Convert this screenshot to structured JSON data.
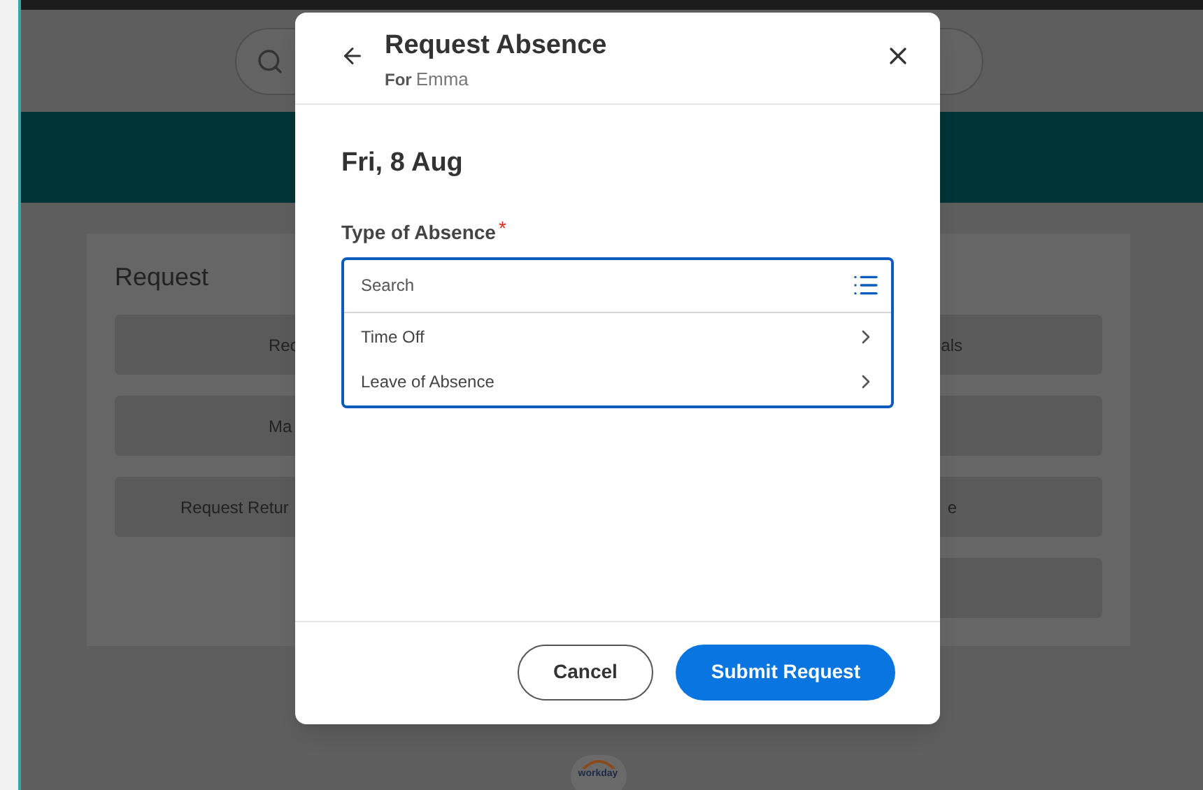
{
  "background": {
    "panel_title": "Request",
    "left_buttons": [
      "Rec",
      "Ma",
      "Request Retur"
    ],
    "right_buttons": [
      {
        "kind": "labeled",
        "label": "als"
      },
      {
        "kind": "blank"
      },
      {
        "kind": "labeled",
        "label": "e"
      },
      {
        "kind": "blank"
      }
    ],
    "logo_text": "workday"
  },
  "dialog": {
    "title": "Request Absence",
    "for_label": "For",
    "for_name": "Emma",
    "date": "Fri, 8 Aug",
    "field": {
      "label": "Type of Absence",
      "required_mark": "*",
      "placeholder": "Search",
      "options": [
        {
          "label": "Time Off"
        },
        {
          "label": "Leave of Absence"
        }
      ]
    },
    "buttons": [
      {
        "label": "Cancel",
        "kind": "secondary"
      },
      {
        "label": "Submit Request",
        "kind": "primary"
      }
    ]
  }
}
